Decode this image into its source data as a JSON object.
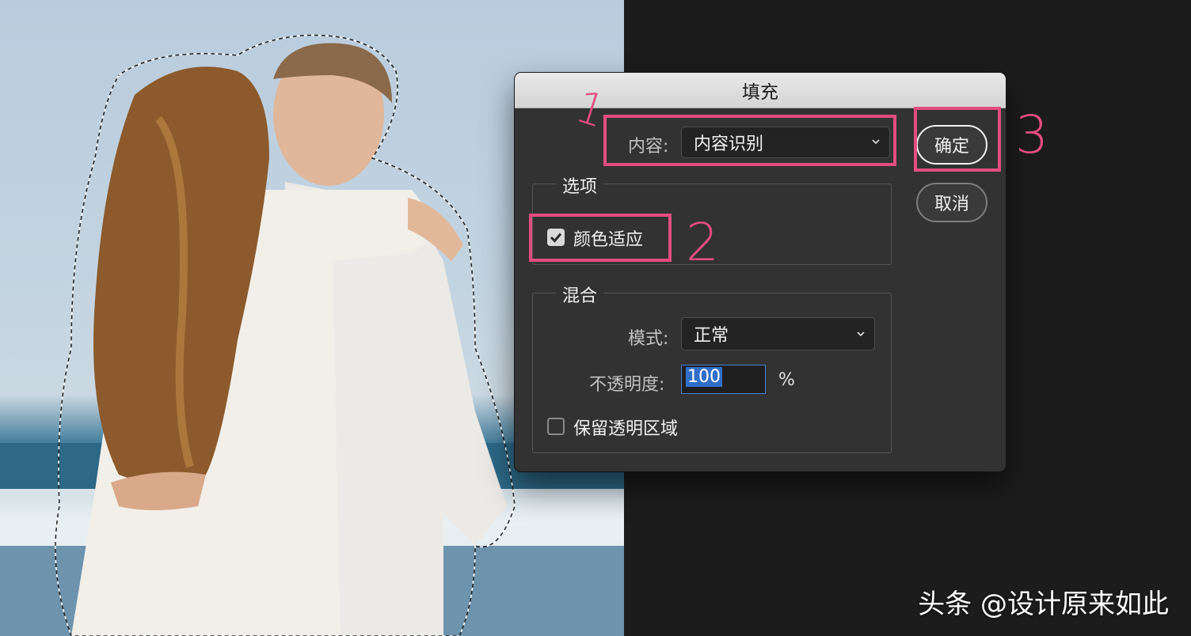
{
  "dialog": {
    "title": "填充",
    "content_label": "内容:",
    "content_value": "内容识别",
    "options_group": "选项",
    "color_adaptation_label": "颜色适应",
    "color_adaptation_checked": true,
    "blend_group": "混合",
    "mode_label": "模式:",
    "mode_value": "正常",
    "opacity_label": "不透明度:",
    "opacity_value": "100",
    "opacity_unit": "%",
    "preserve_transparency_label": "保留透明区域",
    "preserve_transparency_checked": false,
    "ok_label": "确定",
    "cancel_label": "取消"
  },
  "annotations": {
    "step1": "1",
    "step2": "2",
    "step3": "3",
    "color": "#e24d7f"
  },
  "watermark": "头条 @设计原来如此"
}
